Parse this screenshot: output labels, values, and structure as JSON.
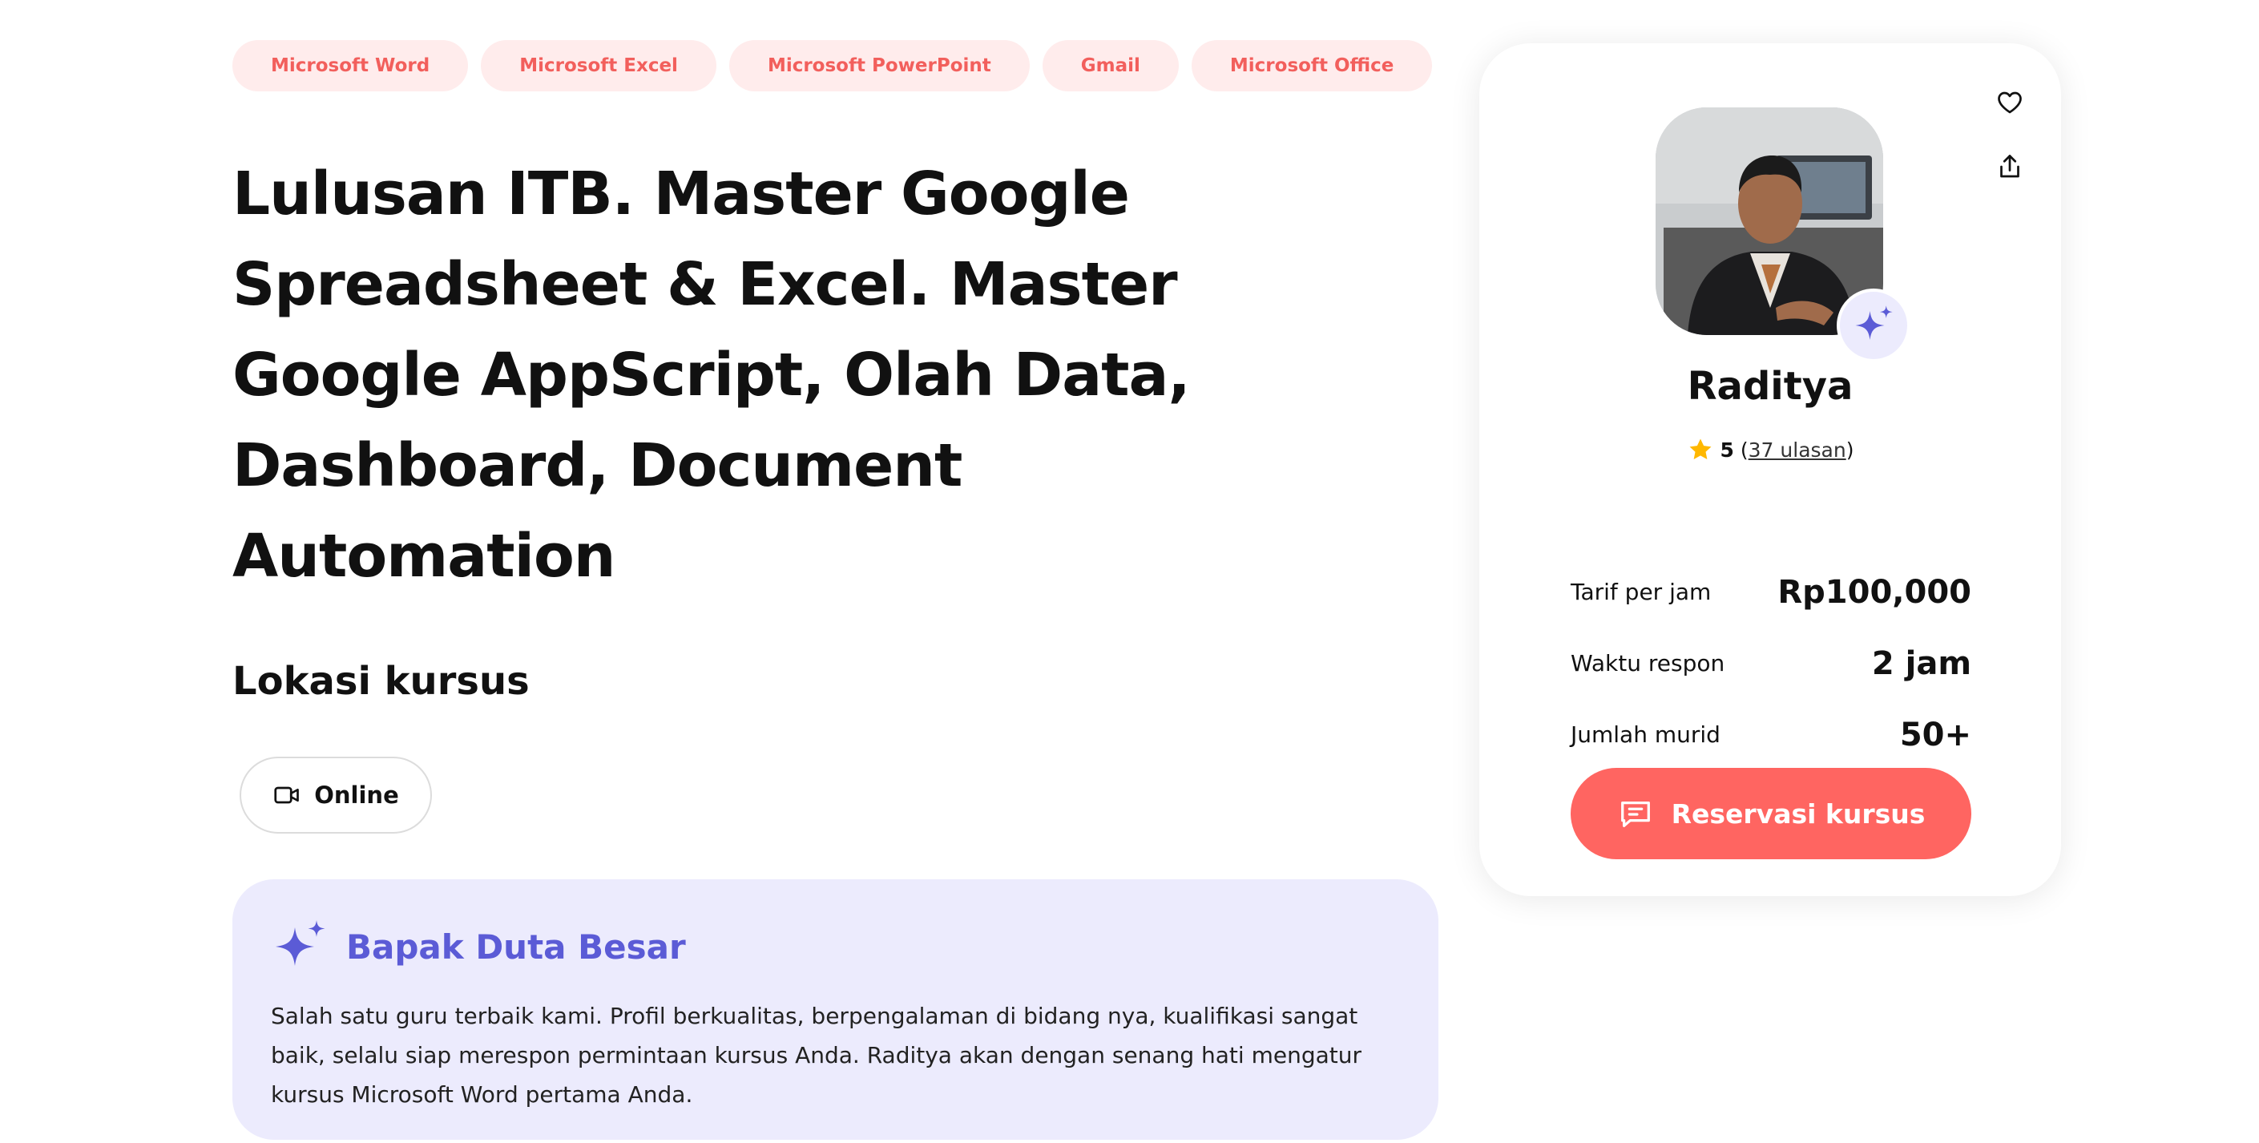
{
  "tags": [
    "Microsoft Word",
    "Microsoft Excel",
    "Microsoft PowerPoint",
    "Gmail",
    "Microsoft Office"
  ],
  "title": "Lulusan ITB. Master Google Spreadsheet & Excel. Master Google AppScript, Olah Data, Dashboard, Document Automation",
  "location": {
    "heading": "Lokasi kursus",
    "online_label": "Online",
    "online_icon": "video-camera-icon"
  },
  "ambassador": {
    "title": "Bapak Duta Besar",
    "icon": "sparkle-icon",
    "text": "Salah satu guru terbaik kami. Profil berkualitas, berpengalaman di bidang nya, kualifikasi sangat baik, selalu siap merespon permintaan kursus Anda. Raditya akan dengan senang hati mengatur kursus Microsoft Word pertama Anda.",
    "accent_color": "#5b5bd6",
    "background": "#ecebfd"
  },
  "tutor": {
    "name": "Raditya",
    "rating_score": "5",
    "rating_open": " (",
    "rating_reviews": "37 ulasan",
    "rating_close": ")",
    "star_color": "#ffb800",
    "stats": [
      {
        "label": "Tarif per jam",
        "value": "Rp100,000"
      },
      {
        "label": "Waktu respon",
        "value": "2 jam"
      },
      {
        "label": "Jumlah murid",
        "value": "50+"
      }
    ],
    "book_label": "Reservasi kursus",
    "book_color": "#ff6561"
  },
  "tag_colors": {
    "background": "#ffecec",
    "text": "#f25f5c"
  }
}
